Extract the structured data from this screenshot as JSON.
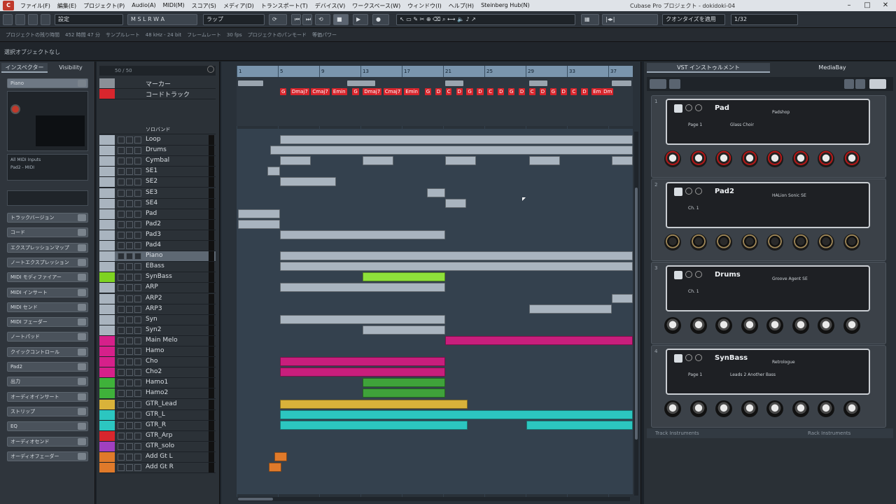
{
  "menu": {
    "items": [
      "ファイル(F)",
      "編集(E)",
      "プロジェクト(P)",
      "Audio(A)",
      "MIDI(M)",
      "スコア(S)",
      "メディア(D)",
      "トランスポート(T)",
      "デバイス(V)",
      "ワークスペース(W)",
      "ウィンドウ(I)",
      "ヘルプ(H)",
      "Steinberg Hub(N)"
    ],
    "window_title": "Cubase Pro プロジェクト - dokidoki-04"
  },
  "toolbar": {
    "preset": "設定",
    "snap": "ラップ",
    "mode": "クオンタイズを適用",
    "quantize": "1/32"
  },
  "info": {
    "items": [
      "プロジェクトの残り時間",
      "452 時間 47 分",
      "サンプルレート",
      "48 kHz - 24 bit",
      "フレームレート",
      "30 fps",
      "プロジェクトのパンモード",
      "等価パワー"
    ]
  },
  "status": "選択オブジェクトなし",
  "inspector": {
    "tabs": [
      "インスペクター",
      "Visibility"
    ],
    "track_name": "Piano",
    "input": "All MIDI Inputs",
    "output": "Pad2 - MIDI",
    "sections": [
      "トラックバージョン",
      "コード",
      "エクスプレッションマップ",
      "ノートエクスプレッション",
      "MIDI モディファイアー",
      "MIDI インサート",
      "MIDI センド",
      "MIDI フェーダー",
      "ノートパッド",
      "クイックコントロール",
      "Pad2",
      "出力",
      "オーディオインサート",
      "ストリップ",
      "EQ",
      "オーディオセンド",
      "オーディオフェーダー"
    ],
    "output_value": "Pad2"
  },
  "tracklist": {
    "header": "50 / 50",
    "top_tracks": [
      {
        "name": "マーカー",
        "color": "#8a9097"
      },
      {
        "name": "コードトラック",
        "color": "#d8262d"
      }
    ],
    "folder_name": "ソロバンド",
    "tracks": [
      {
        "name": "Loop",
        "color": "#a9b4bf"
      },
      {
        "name": "Drums",
        "color": "#a9b4bf"
      },
      {
        "name": "Cymbal",
        "color": "#a9b4bf"
      },
      {
        "name": "SE1",
        "color": "#a9b4bf"
      },
      {
        "name": "SE2",
        "color": "#a9b4bf"
      },
      {
        "name": "SE3",
        "color": "#a9b4bf"
      },
      {
        "name": "SE4",
        "color": "#a9b4bf"
      },
      {
        "name": "Pad",
        "color": "#a9b4bf"
      },
      {
        "name": "Pad2",
        "color": "#a9b4bf"
      },
      {
        "name": "Pad3",
        "color": "#a9b4bf"
      },
      {
        "name": "Pad4",
        "color": "#a9b4bf"
      },
      {
        "name": "Piano",
        "color": "#a9b4bf",
        "selected": true
      },
      {
        "name": "EBass",
        "color": "#a9b4bf"
      },
      {
        "name": "SynBass",
        "color": "#7ed321"
      },
      {
        "name": "ARP",
        "color": "#a9b4bf"
      },
      {
        "name": "ARP2",
        "color": "#a9b4bf"
      },
      {
        "name": "ARP3",
        "color": "#a9b4bf"
      },
      {
        "name": "Syn",
        "color": "#a9b4bf"
      },
      {
        "name": "Syn2",
        "color": "#a9b4bf"
      },
      {
        "name": "Main Melo",
        "color": "#d6208a"
      },
      {
        "name": "Hamo",
        "color": "#d6208a"
      },
      {
        "name": "Cho",
        "color": "#d6208a"
      },
      {
        "name": "Cho2",
        "color": "#d6208a"
      },
      {
        "name": "Hamo1",
        "color": "#3fb13a"
      },
      {
        "name": "Hamo2",
        "color": "#3fb13a"
      },
      {
        "name": "GTR_Lead",
        "color": "#d9b23a"
      },
      {
        "name": "GTR_L",
        "color": "#2cc6c0"
      },
      {
        "name": "GTR_R",
        "color": "#2cc6c0"
      },
      {
        "name": "GTR_Arp",
        "color": "#d8262d"
      },
      {
        "name": "GTR_solo",
        "color": "#a040c0"
      },
      {
        "name": "Add Gt L",
        "color": "#e07a2a"
      },
      {
        "name": "Add Gt R",
        "color": "#e07a2a"
      }
    ]
  },
  "ruler": {
    "bars": [
      "1",
      "5",
      "9",
      "13",
      "17",
      "21",
      "25",
      "29",
      "33",
      "37"
    ]
  },
  "chords": [
    "G",
    "Dmaj7",
    "Cmaj7",
    "Emin",
    "G",
    "Dmaj7",
    "Cmaj7",
    "Emin",
    "G",
    "D",
    "C",
    "D",
    "G",
    "D",
    "C",
    "D",
    "G",
    "D",
    "C",
    "D",
    "G",
    "D",
    "C",
    "D",
    "Em",
    "Dm"
  ],
  "rack": {
    "tabs": [
      "VST インストゥルメント",
      "MediaBay"
    ],
    "instruments": [
      {
        "slot": "1",
        "name": "Pad",
        "preset": "Padshop",
        "page": "Page 1",
        "program": "Glass Choir"
      },
      {
        "slot": "2",
        "name": "Pad2",
        "preset": "HALion Sonic SE",
        "page": "Ch. 1",
        "program": ""
      },
      {
        "slot": "3",
        "name": "Drums",
        "preset": "Groove Agent SE",
        "page": "Ch. 1",
        "program": ""
      },
      {
        "slot": "4",
        "name": "SynBass",
        "preset": "Retrologue",
        "page": "Page 1",
        "program": "Leads 2 Another Bass"
      }
    ],
    "footer_left": "Track Instruments",
    "footer_right": "Rack Instruments"
  }
}
